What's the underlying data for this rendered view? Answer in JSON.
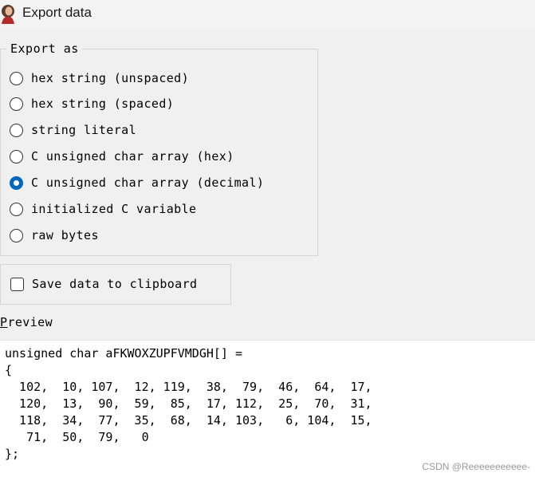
{
  "window": {
    "title": "Export data"
  },
  "export_as": {
    "legend": "Export as",
    "options": [
      {
        "label": "hex string (unspaced)",
        "checked": false
      },
      {
        "label": "hex string (spaced)",
        "checked": false
      },
      {
        "label": "string literal",
        "checked": false
      },
      {
        "label": "C unsigned char array (hex)",
        "checked": false
      },
      {
        "label": "C unsigned char array (decimal)",
        "checked": true
      },
      {
        "label": "initialized C variable",
        "checked": false
      },
      {
        "label": "raw bytes",
        "checked": false
      }
    ]
  },
  "clipboard": {
    "label": "Save data to clipboard",
    "checked": false
  },
  "preview": {
    "label_first": "P",
    "label_rest": "review",
    "lines": [
      "unsigned char aFKWOXZUPFVMDGH[] =",
      "{",
      "  102,  10, 107,  12, 119,  38,  79,  46,  64,  17,",
      "  120,  13,  90,  59,  85,  17, 112,  25,  70,  31,",
      "  118,  34,  77,  35,  68,  14, 103,   6, 104,  15,",
      "   71,  50,  79,   0",
      "};"
    ]
  },
  "watermark": "CSDN @Reeeeeeeeeee-"
}
